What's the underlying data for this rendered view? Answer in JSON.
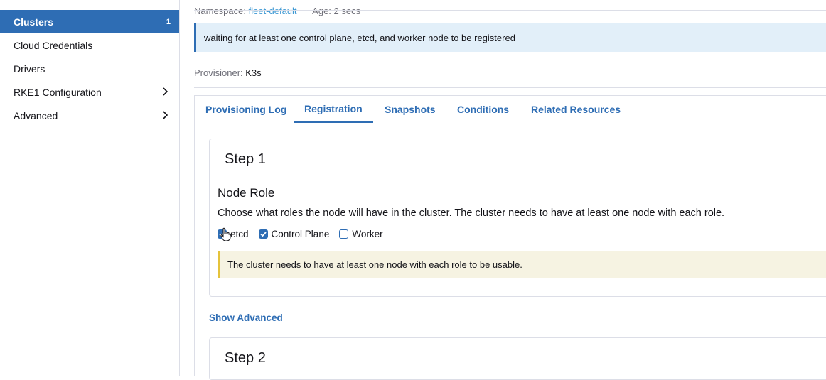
{
  "sidebar": {
    "items": [
      {
        "label": "Clusters",
        "count": "1",
        "active": true
      },
      {
        "label": "Cloud Credentials"
      },
      {
        "label": "Drivers"
      },
      {
        "label": "RKE1 Configuration",
        "expandable": true
      },
      {
        "label": "Advanced",
        "expandable": true
      }
    ]
  },
  "header": {
    "namespace_label": "Namespace:",
    "namespace_value": "fleet-default",
    "age_label": "Age:",
    "age_value": "2 secs"
  },
  "info_banner": "waiting for at least one control plane, etcd, and worker node to be registered",
  "provisioner": {
    "label": "Provisioner:",
    "value": "K3s"
  },
  "tabs": [
    {
      "label": "Provisioning Log"
    },
    {
      "label": "Registration",
      "active": true
    },
    {
      "label": "Snapshots"
    },
    {
      "label": "Conditions"
    },
    {
      "label": "Related Resources"
    }
  ],
  "step1": {
    "title": "Step 1",
    "section_title": "Node Role",
    "description": "Choose what roles the node will have in the cluster. The cluster needs to have at least one node with each role.",
    "roles": [
      {
        "label": "etcd",
        "checked": true
      },
      {
        "label": "Control Plane",
        "checked": true
      },
      {
        "label": "Worker",
        "checked": false
      }
    ],
    "warning": "The cluster needs to have at least one node with each role to be usable."
  },
  "show_advanced": "Show Advanced",
  "step2": {
    "title": "Step 2"
  },
  "colors": {
    "accent": "#2e6db4",
    "link": "#3d98d3",
    "info_bg": "#e2eff9",
    "warn_bg": "#f6f3e2",
    "warn_border": "#e5c33b"
  }
}
